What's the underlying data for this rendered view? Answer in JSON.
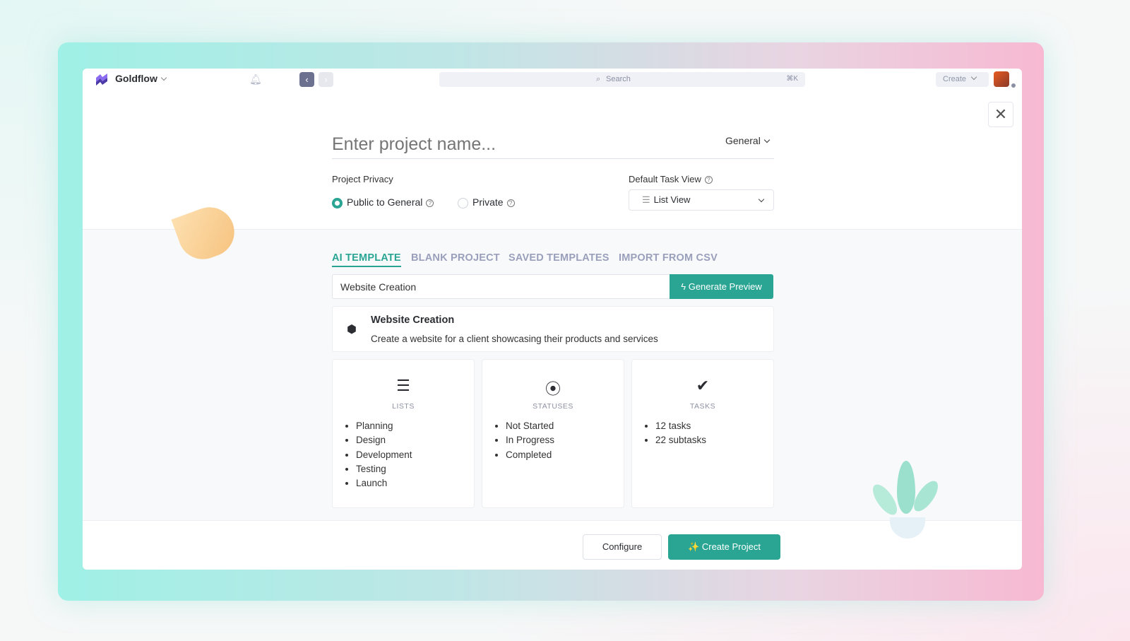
{
  "header": {
    "brand": "Goldflow",
    "search_placeholder": "Search",
    "search_shortcut": "⌘K",
    "create_label": "Create"
  },
  "form": {
    "project_name_placeholder": "Enter project name...",
    "space": "General",
    "privacy_label": "Project Privacy",
    "privacy_options": [
      {
        "label": "Public to General",
        "selected": true
      },
      {
        "label": "Private",
        "selected": false
      }
    ],
    "task_view_label": "Default Task View",
    "task_view_value": "List View"
  },
  "tabs": [
    {
      "label": "AI TEMPLATE",
      "active": true
    },
    {
      "label": "BLANK PROJECT"
    },
    {
      "label": "SAVED TEMPLATES"
    },
    {
      "label": "IMPORT FROM CSV"
    }
  ],
  "template": {
    "input_value": "Website Creation",
    "generate_label": "Generate Preview",
    "title": "Website Creation",
    "description": "Create a website for a client showcasing their products and services"
  },
  "cards": [
    {
      "title": "LISTS",
      "icon": "list-icon",
      "items": [
        "Planning",
        "Design",
        "Development",
        "Testing",
        "Launch"
      ]
    },
    {
      "title": "STATUSES",
      "icon": "status-icon",
      "items": [
        "Not Started",
        "In Progress",
        "Completed"
      ]
    },
    {
      "title": "TASKS",
      "icon": "check-icon",
      "items": [
        "12 tasks",
        "22 subtasks"
      ]
    }
  ],
  "footer": {
    "configure_label": "Configure",
    "create_label": "Create Project"
  },
  "colors": {
    "accent": "#2aa593",
    "tab_inactive": "#9aa0bb"
  }
}
